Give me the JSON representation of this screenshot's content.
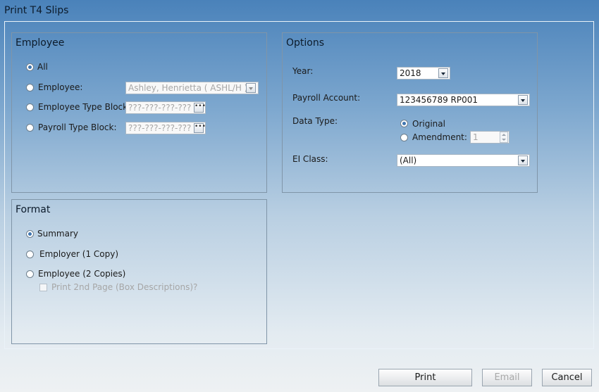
{
  "window": {
    "title": "Print T4 Slips"
  },
  "employee_panel": {
    "title": "Employee",
    "all_label": "All",
    "employee_label": "Employee:",
    "employee_value": "Ashley, Henrietta ( ASHL/H )",
    "employee_type_block_label": "Employee Type Block:",
    "employee_type_block_value": "???-???-???-???",
    "payroll_type_block_label": "Payroll Type Block:",
    "payroll_type_block_value": "???-???-???-???",
    "selected": "All"
  },
  "format_panel": {
    "title": "Format",
    "summary_label": "Summary",
    "employer_label": "Employer (1 Copy)",
    "employee_copies_label": "Employee (2 Copies)",
    "print_2nd_page_label": "Print 2nd Page (Box Descriptions)?",
    "selected": "Summary"
  },
  "options_panel": {
    "title": "Options",
    "year_label": "Year:",
    "year_value": "2018",
    "payroll_account_label": "Payroll Account:",
    "payroll_account_value": "123456789 RP001",
    "data_type_label": "Data Type:",
    "original_label": "Original",
    "amendment_label": "Amendment:",
    "amendment_value": "1",
    "data_type_selected": "Original",
    "ei_class_label": "EI Class:",
    "ei_class_value": "(All)"
  },
  "buttons": {
    "print": "Print",
    "email": "Email",
    "cancel": "Cancel"
  },
  "colors": {
    "accent_radio": "#3f76b0",
    "panel_border": "#8095a8",
    "title_bar": "#4a82ba"
  },
  "icons": [
    "dropdown-arrow-icon",
    "ellipsis-icon",
    "spinner-arrows-icon"
  ]
}
